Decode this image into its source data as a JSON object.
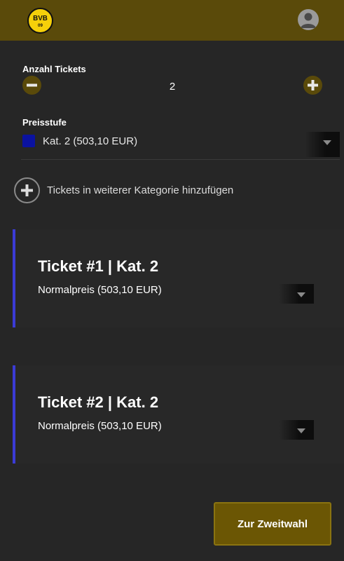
{
  "header": {
    "logo_text_top": "BVB",
    "logo_text_bottom": "09",
    "avatar_icon": "user-profile-icon"
  },
  "quantity": {
    "label": "Anzahl Tickets",
    "value": "2",
    "minus_icon": "minus-icon",
    "plus_icon": "plus-icon"
  },
  "price_tier": {
    "label": "Preisstufe",
    "selected": "Kat. 2 (503,10 EUR)",
    "swatch_color": "#0a12a0"
  },
  "add_category": {
    "label": "Tickets in weiterer Kategorie hinzufügen"
  },
  "tickets": [
    {
      "title": "Ticket #1 | Kat. 2",
      "price_option": "Normalpreis (503,10 EUR)"
    },
    {
      "title": "Ticket #2 | Kat. 2",
      "price_option": "Normalpreis (503,10 EUR)"
    }
  ],
  "footer": {
    "next_button": "Zur Zweitwahl"
  },
  "colors": {
    "background": "#262626",
    "header": "#5a4a0a",
    "accent_gold": "#6b5604",
    "ticket_border": "#3b3bd6",
    "logo_yellow": "#f5d00a"
  }
}
